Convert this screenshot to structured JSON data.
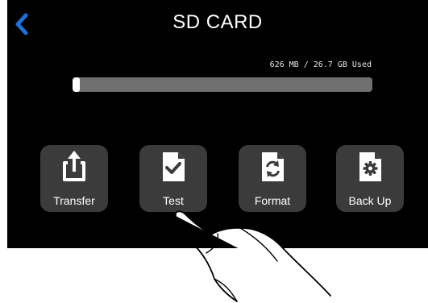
{
  "header": {
    "title": "SD CARD",
    "back_icon": "chevron-left-icon"
  },
  "storage": {
    "usage_text": "626 MB / 26.7 GB Used",
    "used_fraction": 0.023
  },
  "buttons": [
    {
      "label": "Transfer",
      "icon": "share-upload-icon"
    },
    {
      "label": "Test",
      "icon": "file-check-icon"
    },
    {
      "label": "Format",
      "icon": "file-refresh-icon"
    },
    {
      "label": "Back Up",
      "icon": "file-gear-icon"
    }
  ],
  "colors": {
    "screen_bg": "#000000",
    "accent_blue": "#1e6fd9",
    "button_bg": "#3b3b3b",
    "bar_track": "#6f6f6f",
    "bar_fill": "#ffffff"
  }
}
